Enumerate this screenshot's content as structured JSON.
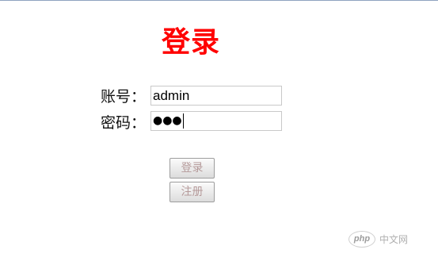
{
  "title": "登录",
  "form": {
    "account_label": "账号：",
    "account_value": "admin",
    "password_label": "密码：",
    "password_masked": "●●●"
  },
  "buttons": {
    "login_label": "登录",
    "register_label": "注册"
  },
  "watermark": {
    "logo_text": "php",
    "site_text": "中文网"
  },
  "colors": {
    "title": "#ff0000",
    "button_text": "#b59a9a"
  }
}
